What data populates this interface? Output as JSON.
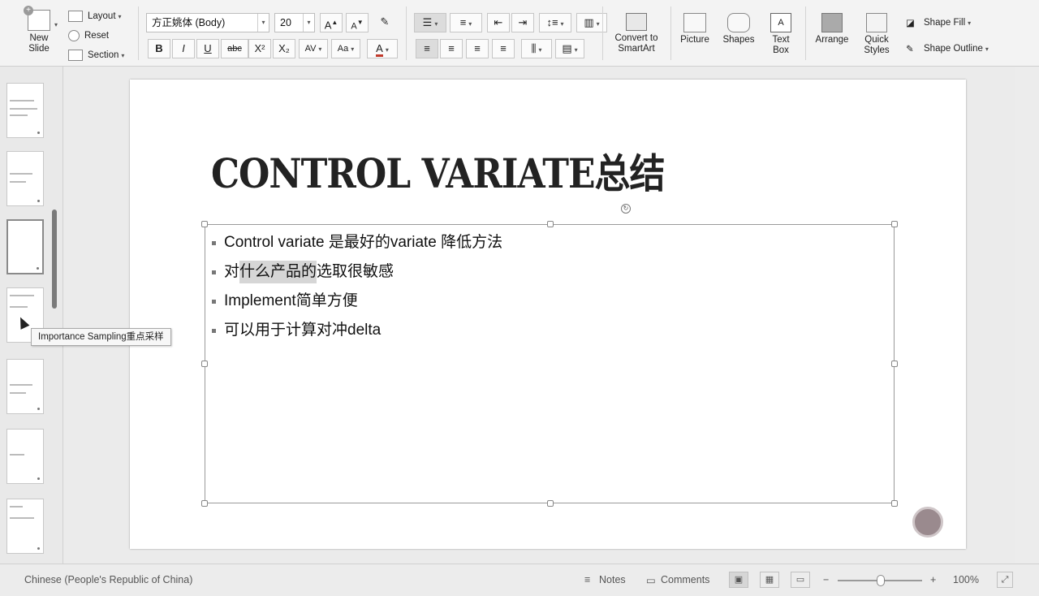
{
  "ribbon": {
    "new_slide": "New\nSlide",
    "new_slide_line1": "New",
    "new_slide_line2": "Slide",
    "layout": "Layout",
    "reset": "Reset",
    "section": "Section",
    "font_name": "方正姚体 (Body)",
    "font_size": "20",
    "bold": "B",
    "italic": "I",
    "underline": "U",
    "strike": "abc",
    "superscript": "X²",
    "subscript": "X₂",
    "char_spacing": "AV",
    "change_case": "Aa",
    "font_color": "A",
    "grow_font": "A",
    "shrink_font": "A",
    "convert_smartart_line1": "Convert to",
    "convert_smartart_line2": "SmartArt",
    "picture": "Picture",
    "shapes": "Shapes",
    "textbox_line1": "Text",
    "textbox_line2": "Box",
    "arrange": "Arrange",
    "quick_styles_line1": "Quick",
    "quick_styles_line2": "Styles",
    "shape_fill": "Shape Fill",
    "shape_outline": "Shape Outline"
  },
  "slide": {
    "title": "CONTROL VARIATE总结",
    "bullets": [
      "Control variate 是最好的variate 降低方法",
      "对什么产品的选取很敏感",
      "Implement简单方便",
      "可以用于计算对冲delta"
    ],
    "bullet2_pre": "对",
    "bullet2_hl": "什么产品的",
    "bullet2_post": "选取很敏感"
  },
  "tooltip": "Importance Sampling重点采样",
  "status": {
    "language": "Chinese (People's Republic of China)",
    "notes": "Notes",
    "comments": "Comments",
    "zoom": "100%",
    "zoom_minus": "−",
    "zoom_plus": "+"
  },
  "colors": {
    "accent_record": "#9a8a8e",
    "ribbon_bg": "#f3f3f3",
    "canvas_bg": "#ebebeb"
  }
}
